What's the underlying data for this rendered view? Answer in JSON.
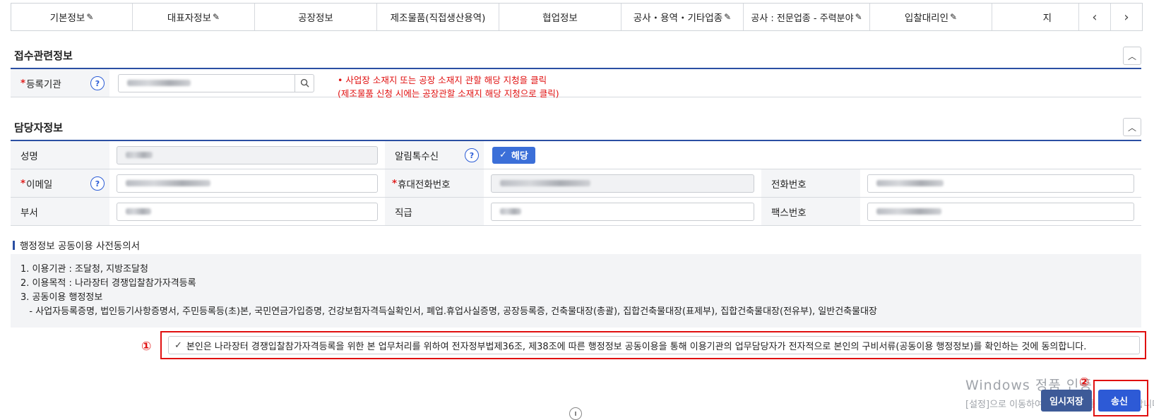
{
  "tabs": [
    {
      "label": "기본정보",
      "edit": "✎"
    },
    {
      "label": "대표자정보",
      "edit": "✎"
    },
    {
      "label": "공장정보",
      "edit": ""
    },
    {
      "label": "제조물품(직접생산용역)",
      "edit": ""
    },
    {
      "label": "협업정보",
      "edit": ""
    },
    {
      "label": "공사・용역・기타업종",
      "edit": "✎"
    },
    {
      "label": "공사 : 전문업종 - 주력분야",
      "edit": "✎"
    },
    {
      "label": "입찰대리인",
      "edit": "✎"
    },
    {
      "label": "지",
      "edit": ""
    }
  ],
  "nav": {
    "prev": "‹",
    "next": "›"
  },
  "reception": {
    "title": "접수관련정보",
    "collapse": "︿",
    "org_label": "등록기관",
    "required_mark": "*",
    "help": "?",
    "search_icon": "search-icon",
    "notes": [
      "• 사업장 소재지 또는 공장 소재지 관할 해당 지청을 클릭",
      "(제조물품 신청 시에는 공장관할 소재지 해당 지청으로 클릭)"
    ]
  },
  "manager": {
    "title": "담당자정보",
    "collapse": "︿",
    "name_label": "성명",
    "alert_label": "알림톡수신",
    "alert_help": "?",
    "alert_check": "✓",
    "alert_value": "해당",
    "email_label": "이메일",
    "email_help": "?",
    "mobile_label": "휴대전화번호",
    "phone_label": "전화번호",
    "dept_label": "부서",
    "position_label": "직급",
    "fax_label": "팩스번호"
  },
  "admin": {
    "title": "행정정보 공동이용 사전동의서",
    "lines": [
      "1. 이용기관 : 조달청, 지방조달청",
      "2. 이용목적 : 나라장터 경쟁입찰참가자격등록",
      "3. 공동이용 행정정보",
      "   - 사업자등록증명, 법인등기사항증명서, 주민등록등(초)본, 국민연금가입증명, 건강보험자격득실확인서, 폐업.휴업사실증명, 공장등록증, 건축물대장(총괄), 집합건축물대장(표제부), 집합건축물대장(전유부), 일반건축물대장"
    ]
  },
  "consent": {
    "marker": "①",
    "check": "✓",
    "text": "본인은 나라장터 경쟁입찰참가자격등록을 위한 본 업무처리를 위하여 전자정부법제36조, 제38조에 따른 행정정보 공동이용을 통해 이용기관의 업무담당자가 전자적으로 본인의 구비서류(공동이용 행정정보)를 확인하는 것에 동의합니다."
  },
  "actions": {
    "marker": "②",
    "temp_save": "임시저장",
    "send": "송신"
  },
  "watermark": {
    "line1": "Windows 정품 인증",
    "line2": "[설정]으로 이동하여 Windows를 정품 인증합니다."
  }
}
